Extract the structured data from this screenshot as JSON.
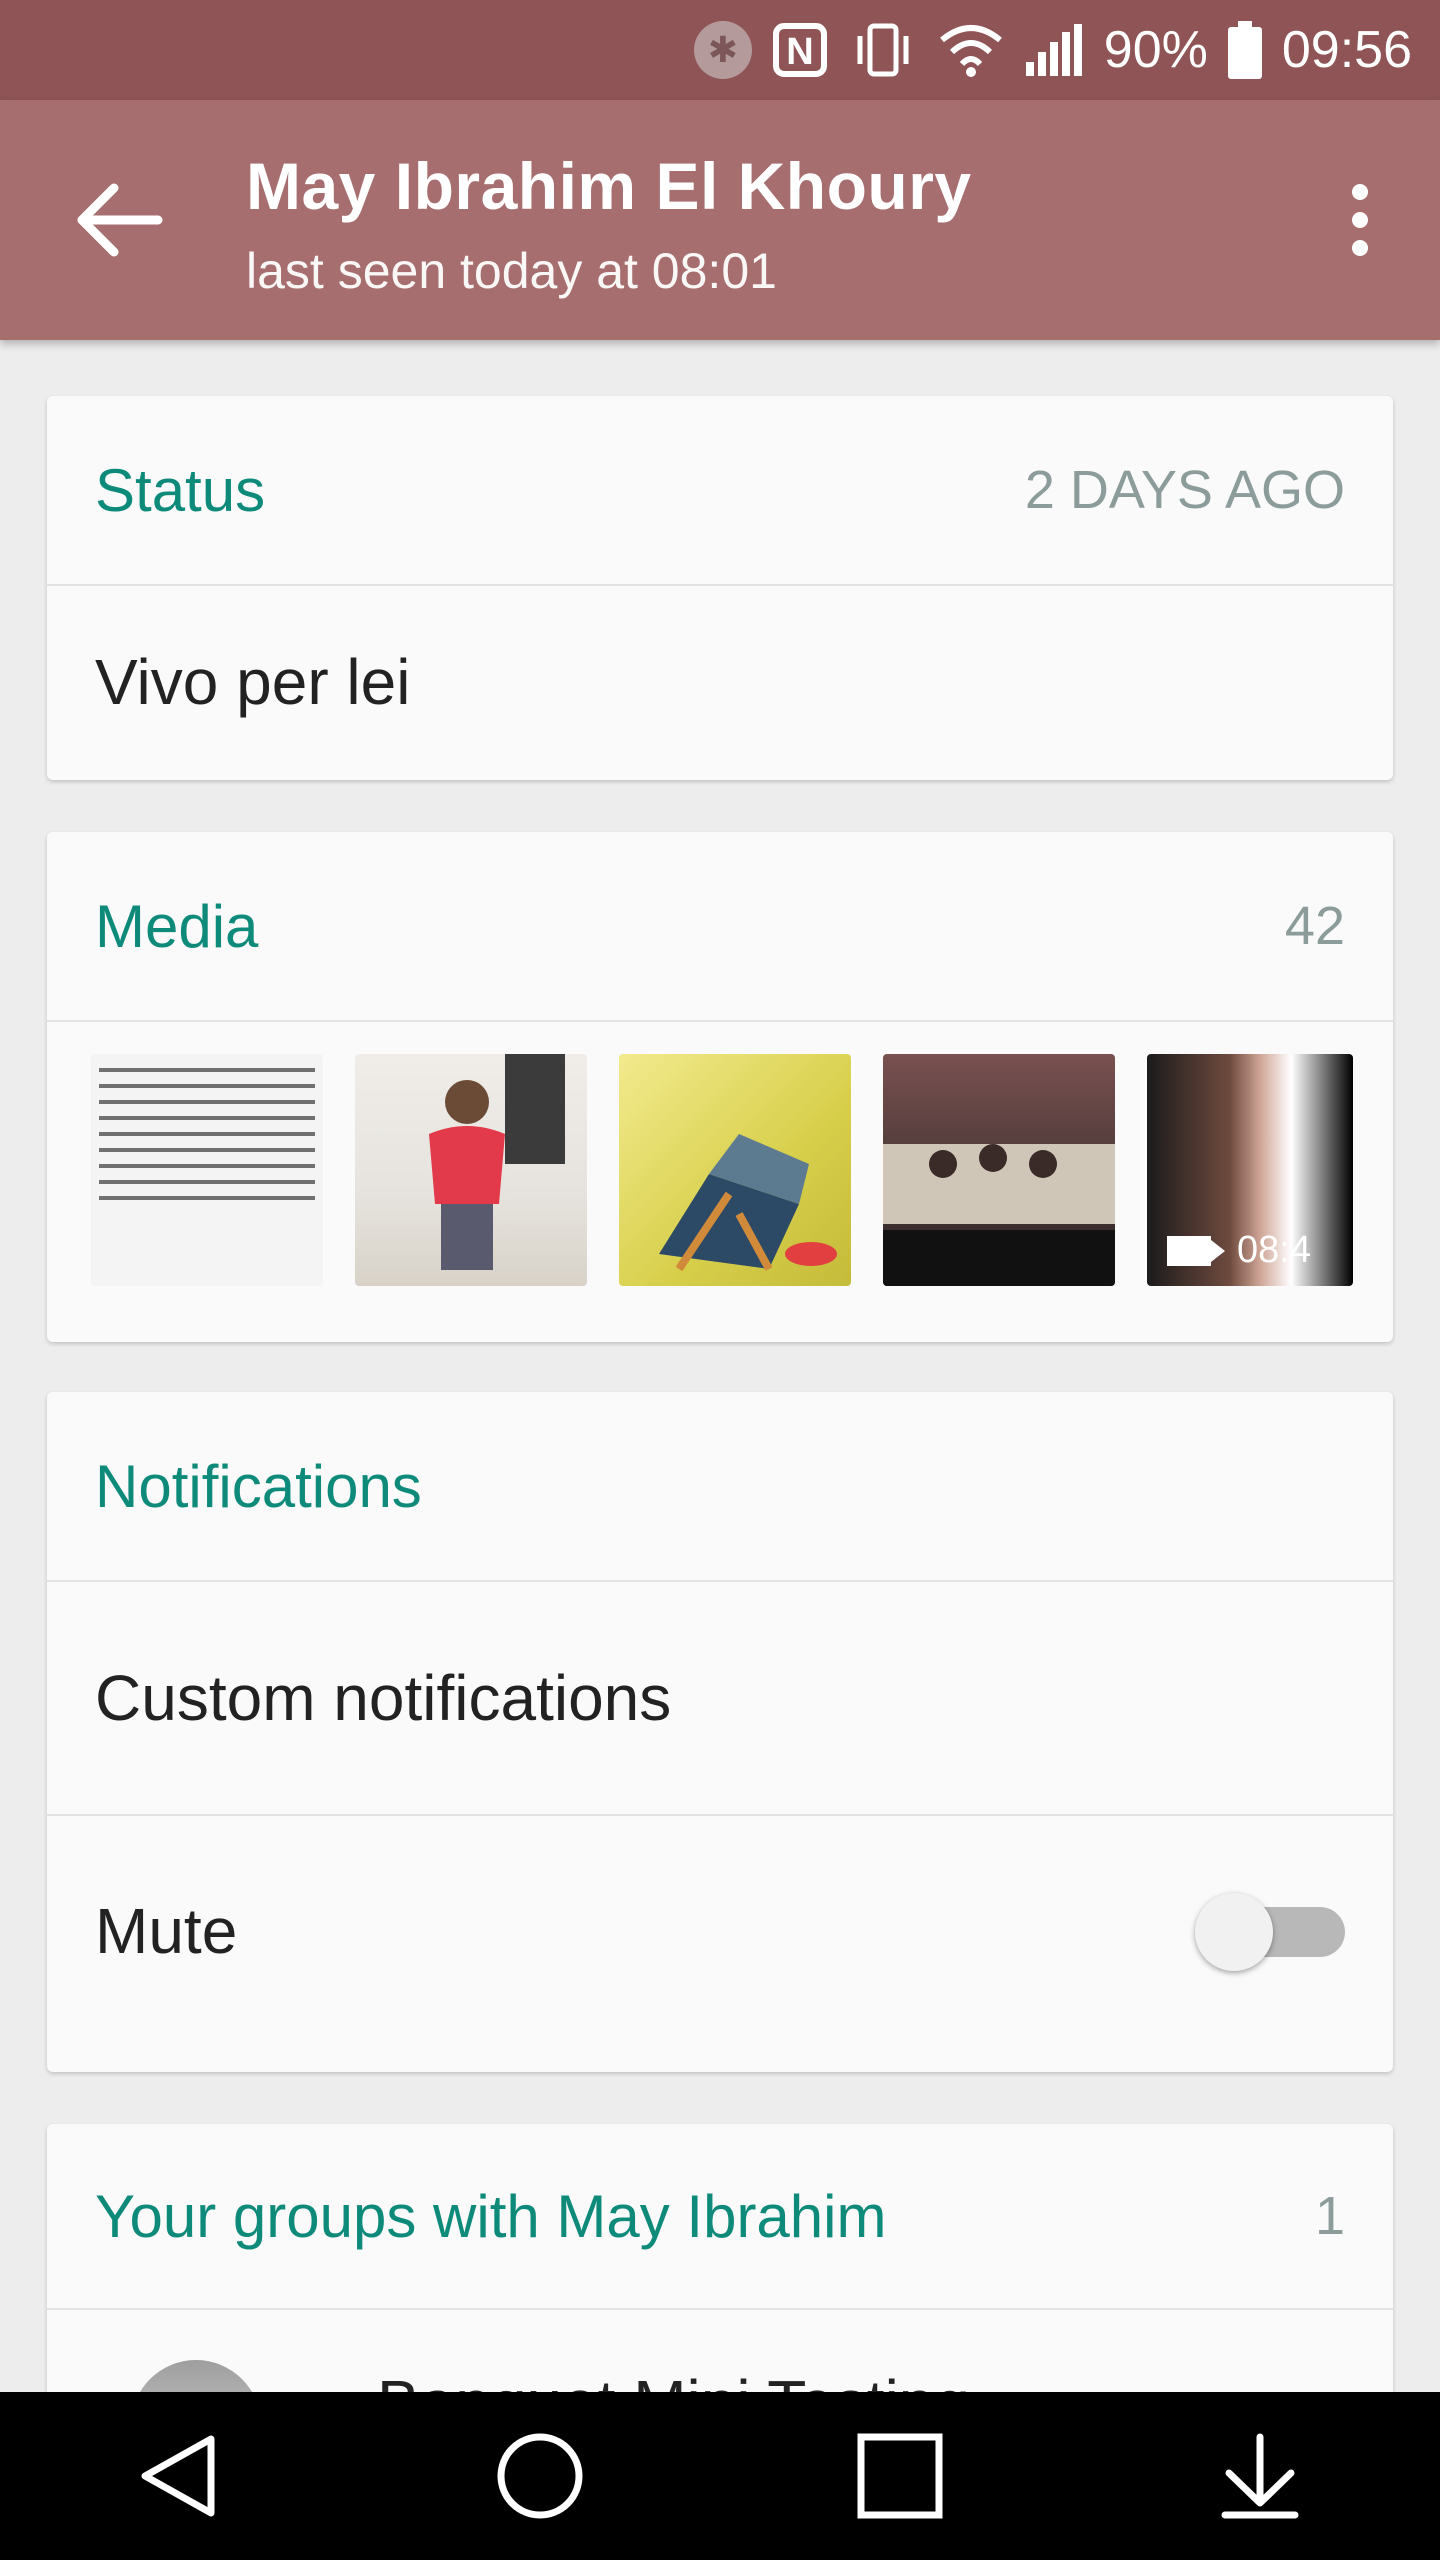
{
  "status_bar": {
    "battery": "90%",
    "time": "09:56",
    "icons": [
      "bluetooth-icon",
      "nfc-icon",
      "vibrate-icon",
      "wifi-icon",
      "signal-icon",
      "battery-icon"
    ]
  },
  "app_bar": {
    "title": "May Ibrahim El Khoury",
    "subtitle": "last seen today at 08:01"
  },
  "status_card": {
    "title": "Status",
    "meta": "2 DAYS AGO",
    "text": "Vivo per lei"
  },
  "media_card": {
    "title": "Media",
    "count": "42",
    "video_duration": "08:4"
  },
  "notifications_card": {
    "title": "Notifications",
    "custom_label": "Custom notifications",
    "mute_label": "Mute",
    "mute_on": false
  },
  "groups_card": {
    "title": "Your groups with May Ibrahim",
    "count": "1",
    "first_group": "Banquet Mini Testing"
  },
  "nav_bar": {
    "icons": [
      "back-icon",
      "home-icon",
      "recents-icon",
      "notification-drawer-icon"
    ]
  },
  "colors": {
    "status_bar": "#8f5456",
    "app_bar": "#a76e70",
    "accent": "#0e8a7a"
  }
}
